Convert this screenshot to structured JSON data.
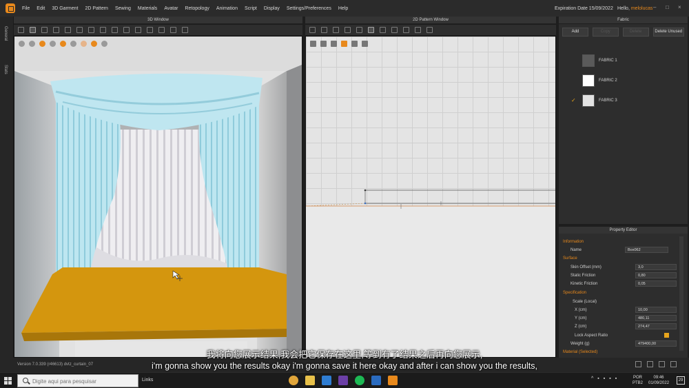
{
  "menubar": {
    "items": [
      "File",
      "Edit",
      "3D Garment",
      "2D Pattern",
      "Sewing",
      "Materials",
      "Avatar",
      "Retopology",
      "Animation",
      "Script",
      "Display",
      "Settings/Preferences",
      "Help"
    ],
    "expiration": "Expiration Date 15/09/2022",
    "hello_prefix": "Hello, ",
    "username": "melolucas"
  },
  "left_tabs": [
    "General",
    "Stats"
  ],
  "panels": {
    "window3d_title": "3D Window",
    "window2d_title": "2D Pattern Window",
    "fabric_title": "Fabric",
    "property_title": "Property Editor"
  },
  "fabric": {
    "buttons": [
      "Add",
      "Copy",
      "Delete",
      "Delete Unused"
    ],
    "items": [
      {
        "label": "FABRIC 1",
        "color": "#5a5a5a",
        "selected": false
      },
      {
        "label": "FABRIC 2",
        "color": "#ffffff",
        "selected": false
      },
      {
        "label": "FABRIC 3",
        "color": "#e2e2e2",
        "selected": true
      }
    ],
    "check_glyph": "✓"
  },
  "property": {
    "sections": {
      "information": "Information",
      "surface": "Surface",
      "specification": "Specification",
      "material": "Material (Selected)"
    },
    "name_label": "Name",
    "name_value": "Box062",
    "skin_offset_label": "Skin Offset (mm)",
    "skin_offset_value": "3,0",
    "static_friction_label": "Static Friction",
    "static_friction_value": "0,80",
    "kinetic_friction_label": "Kinetic Friction",
    "kinetic_friction_value": "0,05",
    "scale_label": "Scale (Local)",
    "x_label": "X (cm)",
    "x_value": "10,00",
    "y_label": "Y (cm)",
    "y_value": "480,11",
    "z_label": "Z (cm)",
    "z_value": "274,47",
    "lock_label": "Lock Aspect Ratio",
    "lock_checked": true,
    "weight_label": "Weight (g)",
    "weight_value": "479400,00"
  },
  "statusbar": {
    "version": "Version    7.0.339 (r46613)    dvtz_curtain_07"
  },
  "subtitles": {
    "zh": "我将向您展示结果,我会把它保存在这里,等到有了结果之后再向您展示,",
    "en": "i'm gonna show you the results okay i'm gonna save it here okay and after i can show you the results,"
  },
  "taskbar": {
    "search_placeholder": "Digite aqui para pesquisar",
    "links": "Links",
    "apps": [
      {
        "name": "chrome-icon",
        "color": "#e0a53a"
      },
      {
        "name": "file-explorer-icon",
        "color": "#e8c14a"
      },
      {
        "name": "photoshop-icon",
        "color": "#2f7dd2"
      },
      {
        "name": "premiere-icon",
        "color": "#6b3fa6"
      },
      {
        "name": "spotify-icon",
        "color": "#1db954"
      },
      {
        "name": "app-blue-icon",
        "color": "#2a6bbf"
      },
      {
        "name": "marvelous-icon",
        "color": "#e8891c"
      }
    ],
    "lang_top": "POR",
    "lang_bottom": "PTB2",
    "time": "09:46",
    "date": "01/09/2022",
    "notifications": "29"
  },
  "colors": {
    "accent": "#e8891c",
    "curtain": "#b9e3ee",
    "sheer": "#ecebee",
    "platform": "#d4960e"
  }
}
